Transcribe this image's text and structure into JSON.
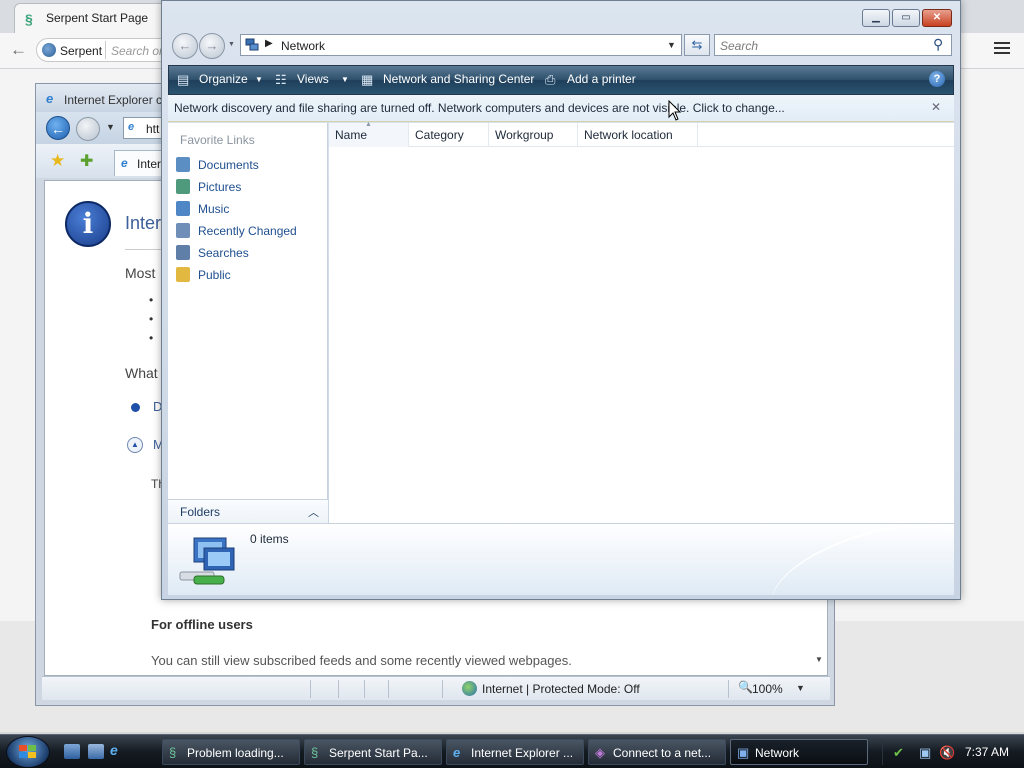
{
  "serpent": {
    "tab_title": "Serpent Start Page",
    "url_label": "Serpent",
    "url_search": "Search or"
  },
  "ie": {
    "title": "Internet Explorer c",
    "address": "htt",
    "tab_label": "Inter",
    "page_heading": "Intern",
    "most": "Most",
    "what": "What",
    "d_text": "D",
    "m_text": "M",
    "th_text": "Th",
    "offline_heading": "For offline users",
    "offline_text": "You can still view subscribed feeds and some recently viewed webpages.",
    "zone": "Internet | Protected Mode: Off",
    "zoom": "100%"
  },
  "network": {
    "address": "Network",
    "search_placeholder": "Search",
    "toolbar": {
      "organize": "Organize",
      "views": "Views",
      "network_sharing": "Network and Sharing Center",
      "add_printer": "Add a printer"
    },
    "infobar": "Network discovery and file sharing are turned off. Network computers and devices are not visible. Click to change...",
    "favorites_heading": "Favorite Links",
    "favorites": [
      {
        "label": "Documents",
        "color": "#5b8fc4"
      },
      {
        "label": "Pictures",
        "color": "#4f9a7c"
      },
      {
        "label": "Music",
        "color": "#4f86c6"
      },
      {
        "label": "Recently Changed",
        "color": "#6f8fb8"
      },
      {
        "label": "Searches",
        "color": "#5f7fa8"
      },
      {
        "label": "Public",
        "color": "#e2b840"
      }
    ],
    "folders": "Folders",
    "columns": [
      "Name",
      "Category",
      "Workgroup",
      "Network location"
    ],
    "items_count": "0 items"
  },
  "taskbar": {
    "tasks": [
      {
        "label": "Problem loading...",
        "icon": "serpent-icon"
      },
      {
        "label": "Serpent Start Pa...",
        "icon": "serpent-icon"
      },
      {
        "label": "Internet Explorer ...",
        "icon": "ie-icon"
      },
      {
        "label": "Connect to a net...",
        "icon": "network-connect-icon"
      },
      {
        "label": "Network",
        "icon": "network-icon"
      }
    ],
    "clock": "7:37 AM"
  }
}
